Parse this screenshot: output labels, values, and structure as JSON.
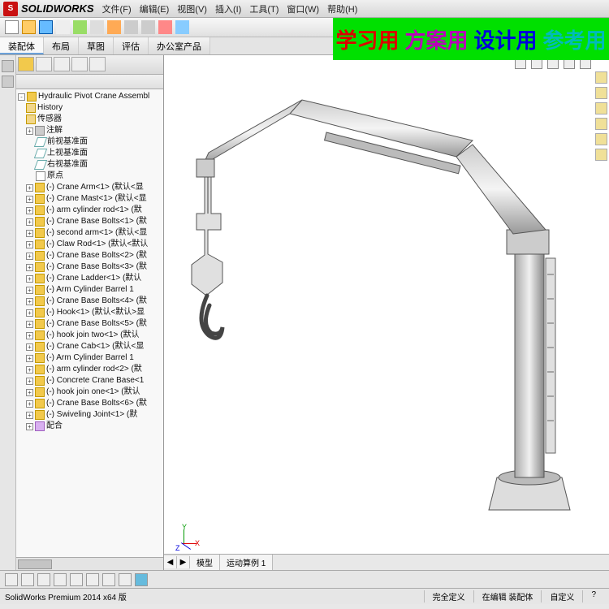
{
  "brand": "SOLIDWORKS",
  "menu": {
    "file": "文件(F)",
    "edit": "编辑(E)",
    "view": "视图(V)",
    "insert": "插入(I)",
    "tools": "工具(T)",
    "window": "窗口(W)",
    "help": "帮助(H)"
  },
  "ribbon": {
    "tabs": [
      "装配体",
      "布局",
      "草图",
      "评估",
      "办公室产品"
    ]
  },
  "banner": {
    "a": "学习用",
    "b": "方案用",
    "c": "设计用",
    "d": "参考用"
  },
  "tree": {
    "root": "Hydraulic Pivot Crane Assembl",
    "history": "History",
    "sensor": "传感器",
    "notes": "注解",
    "planes": [
      "前视基准面",
      "上视基准面",
      "右视基准面"
    ],
    "origin": "原点",
    "parts": [
      "(-) Crane Arm<1> (默认<显",
      "(-) Crane Mast<1> (默认<显",
      "(-) arm cylinder rod<1> (默",
      "(-) Crane Base Bolts<1> (默",
      "(-) second arm<1> (默认<显",
      "(-) Claw Rod<1> (默认<默认",
      "(-) Crane Base Bolts<2> (默",
      "(-) Crane Base Bolts<3> (默",
      "(-) Crane Ladder<1> (默认",
      "(-) Arm Cylinder Barrel 1",
      "(-) Crane Base Bolts<4> (默",
      "(-) Hook<1> (默认<默认>显",
      "(-) Crane Base Bolts<5> (默",
      "(-) hook join two<1> (默认",
      "(-) Crane Cab<1> (默认<显",
      "(-) Arm Cylinder Barrel 1",
      "(-) arm cylinder rod<2> (默",
      "(-) Concrete Crane Base<1",
      "(-) hook join one<1> (默认",
      "(-) Crane Base Bolts<6> (默",
      "(-) Swiveling Joint<1> (默"
    ],
    "mates": "配合"
  },
  "bottom_tabs": {
    "model": "模型",
    "motion": "运动算例 1"
  },
  "axis": {
    "x": "X",
    "y": "Y",
    "z": "Z"
  },
  "status": {
    "version": "SolidWorks Premium 2014 x64 版",
    "defined": "完全定义",
    "editing": "在编辑 装配体",
    "custom": "自定义"
  }
}
